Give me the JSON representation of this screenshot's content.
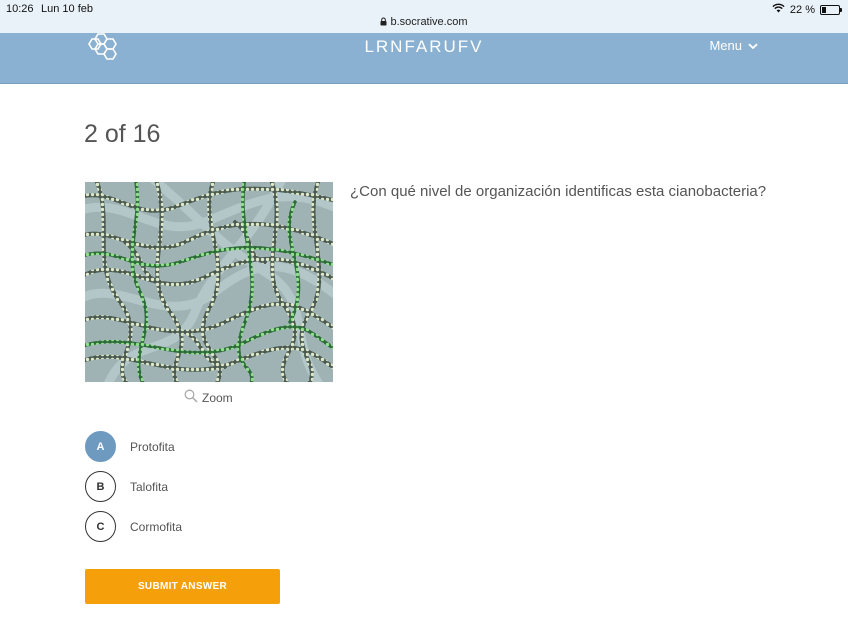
{
  "status_bar": {
    "time": "10:26",
    "date": "Lun 10 feb",
    "url": "b.socrative.com",
    "battery": "22 %",
    "battery_level": 0.22
  },
  "header": {
    "room_name": "LRNFARUFV",
    "menu_label": "Menu",
    "background": "#8ab1d1"
  },
  "question": {
    "progress": "2 of 16",
    "text": "¿Con qué nivel de organización identificas esta cianobacteria?",
    "zoom_label": "Zoom"
  },
  "choices": [
    {
      "letter": "A",
      "label": "Protofita",
      "selected": true
    },
    {
      "letter": "B",
      "label": "Talofita",
      "selected": false
    },
    {
      "letter": "C",
      "label": "Cormofita",
      "selected": false
    }
  ],
  "submit": {
    "label": "SUBMIT ANSWER",
    "color": "#f5a00a"
  }
}
